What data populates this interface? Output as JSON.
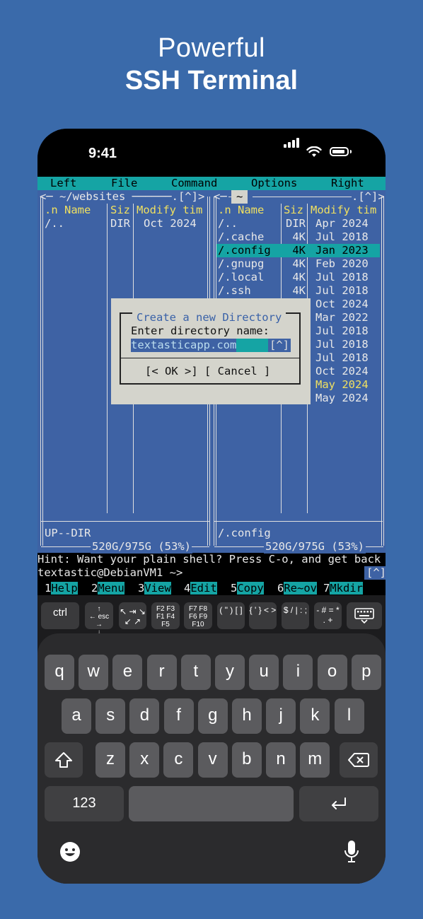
{
  "headline": {
    "line1": "Powerful",
    "line2": "SSH Terminal"
  },
  "status_bar": {
    "time": "9:41"
  },
  "mc_menu": [
    "Left",
    "File",
    "Command",
    "Options",
    "Right"
  ],
  "left_panel": {
    "title": "<─ ~/websites ──────.[^]>",
    "headers": {
      "name": ".n Name",
      "size": "Siz",
      "mtime": "Modify tim"
    },
    "rows": [
      {
        "name": "/..",
        "size": "DIR",
        "mtime": "Oct 2024"
      }
    ],
    "status": "UP--DIR",
    "disk": "520G/975G (53%)"
  },
  "right_panel": {
    "title_left": "<─",
    "title_center": "~",
    "title_right": ".[^]>",
    "headers": {
      "name": ".n Name",
      "size": "Siz",
      "mtime": "Modify tim"
    },
    "rows": [
      {
        "name": "/..",
        "size": "DIR",
        "mtime": "Apr 2024"
      },
      {
        "name": "/.cache",
        "size": "4K",
        "mtime": "Jul 2018"
      },
      {
        "name": "/.config",
        "size": "4K",
        "mtime": "Jan 2023"
      },
      {
        "name": "/.gnupg",
        "size": "4K",
        "mtime": "Feb 2020"
      },
      {
        "name": "/.local",
        "size": "4K",
        "mtime": "Jul 2018"
      },
      {
        "name": "/.ssh",
        "size": "4K",
        "mtime": "Jul 2018"
      },
      {
        "name": "",
        "size": "",
        "mtime": "Oct 2024"
      },
      {
        "name": "",
        "size": "",
        "mtime": "Mar 2022"
      },
      {
        "name": "",
        "size": "",
        "mtime": "Jul 2018"
      },
      {
        "name": "",
        "size": "",
        "mtime": "Jul 2018"
      },
      {
        "name": "",
        "size": "",
        "mtime": "Jul 2018"
      },
      {
        "name": "",
        "size": "",
        "mtime": "Oct 2024"
      },
      {
        "name": "",
        "size": "",
        "mtime": "May 2024"
      },
      {
        "name": "",
        "size": "",
        "mtime": "May 2024"
      }
    ],
    "selected_index": 2,
    "highlight_index": 12,
    "status": "/.config",
    "disk": "520G/975G (53%)"
  },
  "dialog": {
    "title": "Create a new Directory",
    "label": "Enter directory name:",
    "value": "textasticapp.com",
    "history": "[^]",
    "ok_label": "[< OK >]",
    "cancel_label": "[ Cancel ]"
  },
  "shell": {
    "hint": "Hint: Want your plain shell? Press C-o, and get back",
    "prompt": "textastic@DebianVM1 ~>",
    "history_btn": "[^]"
  },
  "fkeys": [
    {
      "num": "1",
      "label": "Help"
    },
    {
      "num": "2",
      "label": "Menu"
    },
    {
      "num": "3",
      "label": "View"
    },
    {
      "num": "4",
      "label": "Edit"
    },
    {
      "num": "5",
      "label": "Copy"
    },
    {
      "num": "6",
      "label": "Re~ov"
    },
    {
      "num": "7",
      "label": "Mkdir"
    }
  ],
  "accessory": {
    "ctrl": "ctrl",
    "esc": "esc",
    "f_keys_1": "F2 F3 F1 F4 F5",
    "f_keys_2": "F7 F8 F6 F9 F10",
    "brackets": "( \" ) [ ]",
    "braces": "{ ' } < >",
    "symbols": "$ / | : ;",
    "ops": "- # = * . +"
  },
  "keyboard": {
    "row1": [
      "q",
      "w",
      "e",
      "r",
      "t",
      "y",
      "u",
      "i",
      "o",
      "p"
    ],
    "row2": [
      "a",
      "s",
      "d",
      "f",
      "g",
      "h",
      "j",
      "k",
      "l"
    ],
    "row3": [
      "z",
      "x",
      "c",
      "v",
      "b",
      "n",
      "m"
    ],
    "numbers_key": "123"
  }
}
